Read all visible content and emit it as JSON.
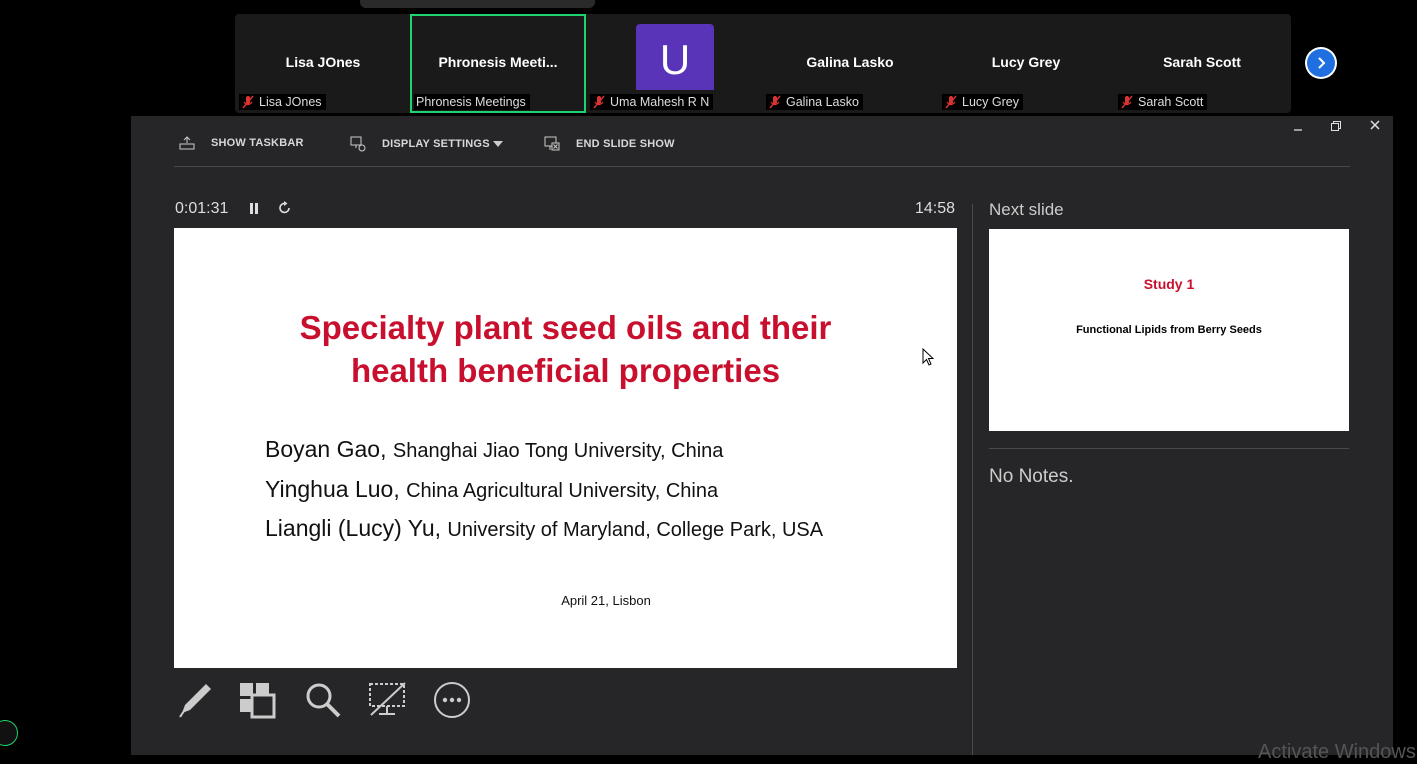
{
  "participants": [
    {
      "display": "Lisa JOnes",
      "label": "Lisa JOnes",
      "muted": true
    },
    {
      "display": "Phronesis  Meeti...",
      "label": "Phronesis Meetings",
      "muted": false
    },
    {
      "display": "U",
      "label": "Uma Mahesh R N",
      "muted": true
    },
    {
      "display": "Galina Lasko",
      "label": "Galina Lasko",
      "muted": true
    },
    {
      "display": "Lucy Grey",
      "label": "Lucy Grey",
      "muted": true
    },
    {
      "display": "Sarah Scott",
      "label": "Sarah Scott",
      "muted": true
    }
  ],
  "toolbar": {
    "show_taskbar": "SHOW TASKBAR",
    "display_settings": "DISPLAY SETTINGS",
    "end_slide_show": "END SLIDE SHOW"
  },
  "timer": {
    "elapsed": "0:01:31",
    "clock": "14:58"
  },
  "slide": {
    "title_line1": "Specialty plant seed oils and their",
    "title_line2": "health beneficial properties",
    "authors": [
      {
        "name": "Boyan Gao,",
        "affiliation": "Shanghai Jiao Tong University, China"
      },
      {
        "name": "Yinghua Luo,",
        "affiliation": "China Agricultural University, China"
      },
      {
        "name": "Liangli (Lucy) Yu,",
        "affiliation": "University of Maryland, College Park, USA"
      }
    ],
    "date": "April 21, Lisbon"
  },
  "next_slide": {
    "label": "Next slide",
    "title": "Study 1",
    "subtitle": "Functional Lipids from Berry Seeds"
  },
  "notes": "No Notes.",
  "watermark": "Activate Windows",
  "colors": {
    "accent_red": "#c8102e",
    "active_border": "#1fd36e",
    "avatar_purple": "#5a34b8",
    "next_blue": "#1f6fe0"
  }
}
